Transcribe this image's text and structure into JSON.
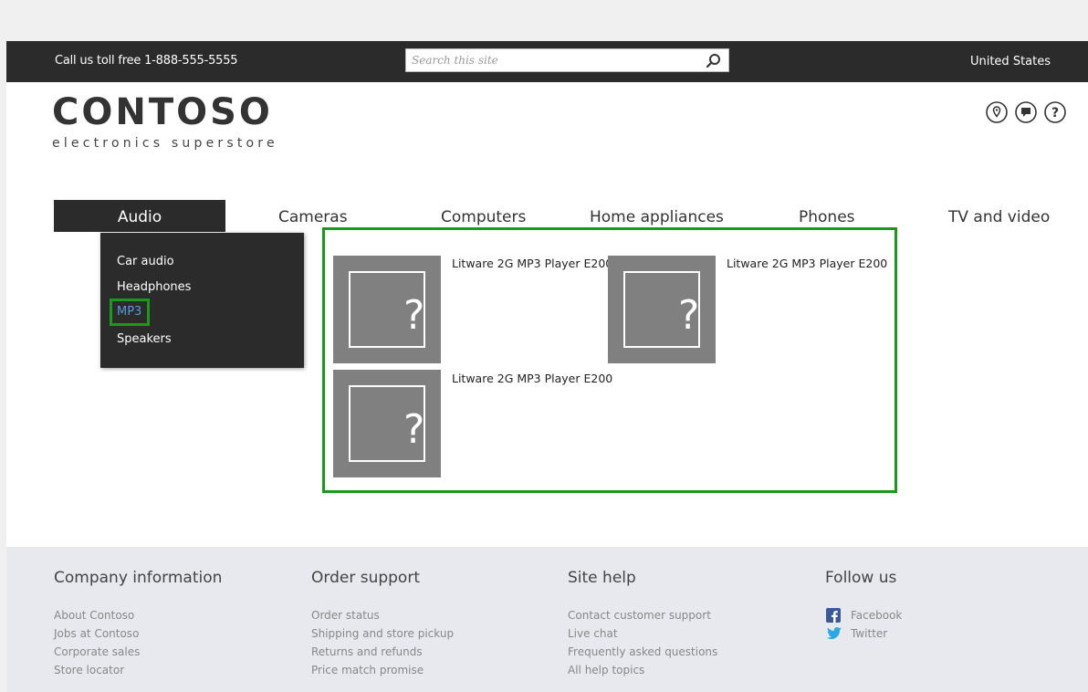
{
  "topbar": {
    "phone_text": "Call us toll free 1-888-555-5555",
    "search_placeholder": "Search this site",
    "region": "United States"
  },
  "logo": {
    "title": "CONTOSO",
    "subtitle": "electronics superstore"
  },
  "utility_icons": [
    "location-icon",
    "chat-icon",
    "help-icon"
  ],
  "nav": {
    "items": [
      {
        "label": "Audio",
        "active": true
      },
      {
        "label": "Cameras"
      },
      {
        "label": "Computers"
      },
      {
        "label": "Home appliances"
      },
      {
        "label": "Phones"
      },
      {
        "label": "TV and video"
      }
    ],
    "dropdown": [
      "Car audio",
      "Headphones",
      "MP3",
      "Speakers"
    ],
    "selected_subcategory": "MP3"
  },
  "products": [
    {
      "name": "Litware 2G MP3 Player E200",
      "image": "placeholder-question-icon"
    },
    {
      "name": "Litware 2G MP3 Player E200",
      "image": "placeholder-question-icon"
    },
    {
      "name": "Litware 2G MP3 Player E200",
      "image": "placeholder-question-icon"
    }
  ],
  "footer": {
    "columns": [
      {
        "heading": "Company information",
        "links": [
          "About Contoso",
          "Jobs at Contoso",
          "Corporate sales",
          "Store locator"
        ]
      },
      {
        "heading": "Order support",
        "links": [
          "Order status",
          "Shipping and store pickup",
          "Returns and refunds",
          "Price match promise"
        ]
      },
      {
        "heading": "Site help",
        "links": [
          "Contact customer support",
          "Live chat",
          "Frequently asked questions",
          "All help topics"
        ]
      },
      {
        "heading": "Follow us",
        "links": [
          "Facebook",
          "Twitter"
        ]
      }
    ]
  },
  "colors": {
    "topbar_bg": "#2b2b2b",
    "highlight_border": "#1a9a1a",
    "selected_link": "#5a9ad6",
    "footer_bg": "#e7e9ee",
    "placeholder_gray": "#808080"
  }
}
